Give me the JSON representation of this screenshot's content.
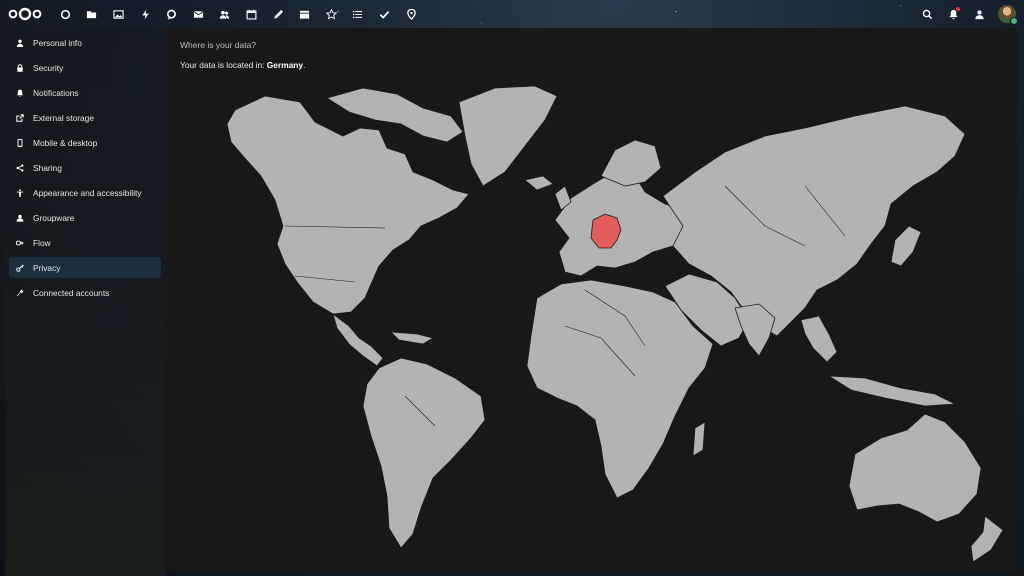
{
  "topbar": {
    "apps": [
      {
        "name": "dashboard-icon"
      },
      {
        "name": "files-icon"
      },
      {
        "name": "photos-icon"
      },
      {
        "name": "activity-icon"
      },
      {
        "name": "talk-icon"
      },
      {
        "name": "mail-icon"
      },
      {
        "name": "contacts-icon"
      },
      {
        "name": "calendar-icon"
      },
      {
        "name": "notes-icon"
      },
      {
        "name": "deck-icon"
      },
      {
        "name": "tasks-icon"
      },
      {
        "name": "list-icon"
      },
      {
        "name": "checkmark-icon"
      },
      {
        "name": "maps-icon"
      }
    ],
    "right": [
      "search-icon",
      "notifications-icon",
      "contacts-menu-icon"
    ]
  },
  "sidebar": {
    "items": [
      {
        "label": "Personal info",
        "icon": "person-icon",
        "active": false
      },
      {
        "label": "Security",
        "icon": "lock-icon",
        "active": false
      },
      {
        "label": "Notifications",
        "icon": "bell-icon",
        "active": false
      },
      {
        "label": "External storage",
        "icon": "external-storage-icon",
        "active": false
      },
      {
        "label": "Mobile & desktop",
        "icon": "phone-icon",
        "active": false
      },
      {
        "label": "Sharing",
        "icon": "share-icon",
        "active": false
      },
      {
        "label": "Appearance and accessibility",
        "icon": "accessibility-icon",
        "active": false
      },
      {
        "label": "Groupware",
        "icon": "groupware-icon",
        "active": false
      },
      {
        "label": "Flow",
        "icon": "flow-icon",
        "active": false
      },
      {
        "label": "Privacy",
        "icon": "key-icon",
        "active": true
      },
      {
        "label": "Connected accounts",
        "icon": "wrench-icon",
        "active": false
      }
    ]
  },
  "main": {
    "question": "Where is your data?",
    "location_prefix": "Your data is located in:",
    "country": "Germany"
  },
  "colors": {
    "land": "#b3b3b3",
    "highlight": "#e35d5d",
    "active_item": "#223446",
    "panel": "#181818"
  }
}
